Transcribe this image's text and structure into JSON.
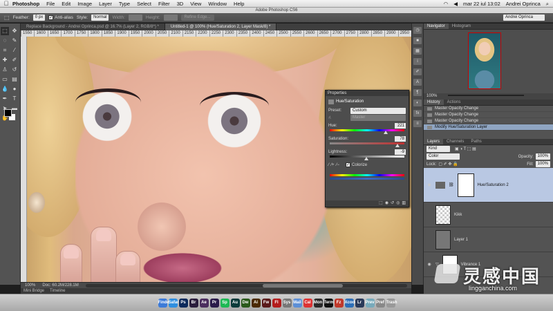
{
  "menubar": {
    "app": "Photoshop",
    "items": [
      "File",
      "Edit",
      "Image",
      "Layer",
      "Type",
      "Select",
      "Filter",
      "3D",
      "View",
      "Window",
      "Help"
    ],
    "clock": "mar 22 iul 13:02",
    "user": "Andrei Oprinca"
  },
  "titlebar": {
    "title": "Adobe Photoshop CS6"
  },
  "options": {
    "feather_label": "Feather:",
    "feather_value": "0 px",
    "antialias_label": "Anti-alias",
    "style_label": "Style:",
    "style_value": "Normal",
    "width_label": "Width:",
    "height_label": "Height:",
    "refine_label": "Refine Edge...",
    "workspace": "Andrei Oprinca"
  },
  "doctabs": [
    {
      "label": "Replace Background - Andrei Oprinca.psd @ 16.7% (Layer 2, RGB/8*) *"
    },
    {
      "label": "Untitled-1 @ 100% (Hue/Saturation 2, Layer Mask/8) *"
    }
  ],
  "ruler": {
    "ticks": [
      "1550",
      "1600",
      "1650",
      "1700",
      "1750",
      "1800",
      "1850",
      "1900",
      "1950",
      "2000",
      "2050",
      "2100",
      "2150",
      "2200",
      "2250",
      "2300",
      "2350",
      "2400",
      "2450",
      "2500",
      "2550",
      "2600",
      "2650",
      "2700",
      "2750",
      "2800",
      "2850",
      "2900",
      "2950"
    ]
  },
  "status": {
    "zoom": "100%",
    "doc": "Doc: 60.2M/228.1M"
  },
  "minibridge": {
    "tab1": "Mini Bridge",
    "tab2": "Timeline"
  },
  "navigator": {
    "tab1": "Navigator",
    "tab2": "Histogram",
    "zoom": "100%"
  },
  "history": {
    "tab1": "History",
    "tab2": "Actions",
    "items": [
      "Master Opacity Change",
      "Master Opacity Change",
      "Master Opacity Change",
      "Modify Hue/Saturation Layer"
    ]
  },
  "layers": {
    "tab1": "Layers",
    "tab2": "Channels",
    "tab3": "Paths",
    "kind": "Kind",
    "blend": "Color",
    "opacity_label": "Opacity:",
    "opacity_value": "100%",
    "lock_label": "Lock:",
    "fill_label": "Fill:",
    "fill_value": "100%",
    "items": [
      {
        "name": "Hue/Saturation 2"
      },
      {
        "name": "Kikk"
      },
      {
        "name": "Layer 1"
      },
      {
        "name": "Vibrance 1"
      }
    ]
  },
  "properties": {
    "title": "Properties",
    "type": "Hue/Saturation",
    "preset_label": "Preset:",
    "preset_value": "Custom",
    "channel_value": "Master",
    "hue_label": "Hue:",
    "hue_value": "221",
    "sat_label": "Saturation:",
    "sat_value": "78",
    "light_label": "Lightness:",
    "light_value": "-9",
    "colorize_label": "Colorize"
  },
  "watermark": {
    "cn": "灵感中国",
    "url": "lingganchina.com"
  },
  "dock": [
    "Finder",
    "Safari",
    "Ps",
    "Br",
    "Ae",
    "Pr",
    "Sp",
    "Au",
    "Dw",
    "Ai",
    "Fw",
    "Fl",
    "Sys",
    "Mail",
    "Cal",
    "Mon",
    "Term",
    "Fz",
    "Xcode",
    "Lr",
    "Prev",
    "Pref",
    "Trash"
  ]
}
